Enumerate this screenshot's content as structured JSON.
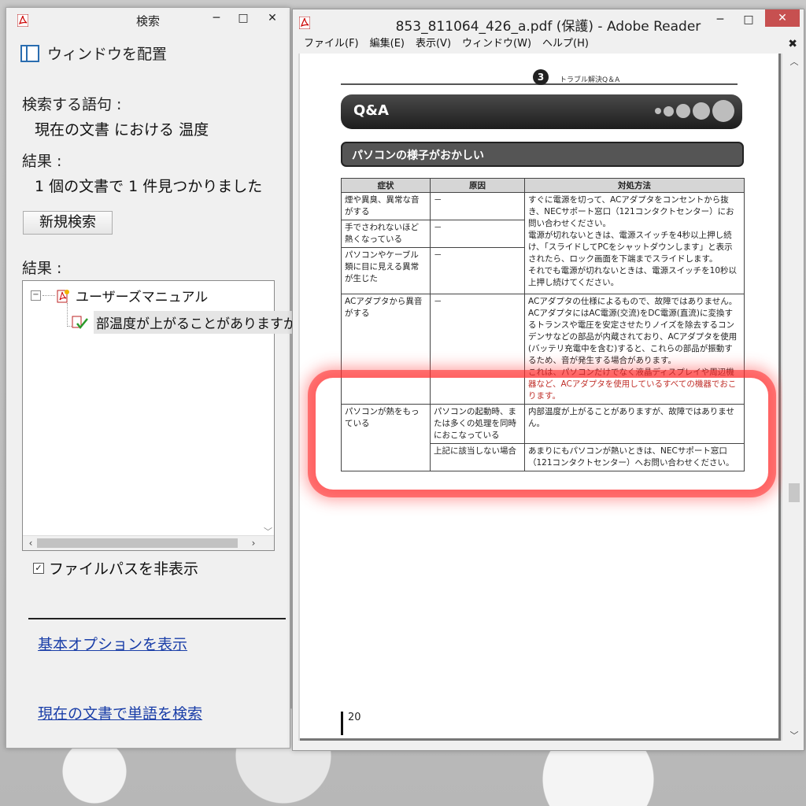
{
  "search_window": {
    "title": "検索",
    "arrange_label": "ウィンドウを配置",
    "query_label": "検索する語句 :",
    "query_value": "現在の文書 における 温度",
    "result_label": "結果 :",
    "result_value": "1 個の文書で 1 件見つかりました",
    "new_search_button": "新規検索",
    "results_label": "結果 :",
    "tree": {
      "doc_name": "ユーザーズマニュアル",
      "hit_text": "部温度が上がることがありますが"
    },
    "hide_path_label": "ファイルパスを非表示",
    "hide_path_checked": true,
    "link_options": "基本オプションを表示",
    "link_word_search": "現在の文書で単語を検索"
  },
  "reader_window": {
    "title": "853_811064_426_a.pdf (保護) - Adobe Reader",
    "menu": [
      "ファイル(F)",
      "編集(E)",
      "表示(V)",
      "ウィンドウ(W)",
      "ヘルプ(H)"
    ],
    "page": {
      "chapter_number": "3",
      "chapter_title": "トラブル解決Q＆A",
      "qa_label": "Q&A",
      "section_title": "パソコンの様子がおかしい",
      "table_headers": [
        "症状",
        "原因",
        "対処方法"
      ],
      "rows": {
        "r1_symptom": "煙や異臭、異常な音がする",
        "r2_symptom": "手でさわれないほど熱くなっている",
        "r3_symptom": "パソコンやケーブル類に目に見える異常が生じた",
        "dash": "－",
        "r1_remedy": "すぐに電源を切って、ACアダプタをコンセントから抜き、NECサポート窓口（121コンタクトセンター）にお問い合わせください。\n電源が切れないときは、電源スイッチを4秒以上押し続け、「スライドしてPCをシャットダウンします」と表示されたら、ロック画面を下端までスライドします。\nそれでも電源が切れないときは、電源スイッチを10秒以上押し続けてください。",
        "r4_symptom": "ACアダプタから異音がする",
        "r4_remedy_a": "ACアダプタの仕様によるもので、故障ではありません。ACアダプタにはAC電源(交流)をDC電源(直流)に変換するトランスや電圧を安定させたりノイズを除去するコンデンサなどの部品が内蔵されており、ACアダプタを使用(バッテリ充電中を含む)すると、これらの部品が振動するため、音が発生する場合があります。\nこれは、パソコンだけでなく液晶ディスプレイや周辺機",
        "r4_remedy_b": "器など、ACアダプタを使用しているすべての機器でおこります。",
        "r5_symptom": "パソコンが熱をもっている",
        "r5_cause": "パソコンの起動時、または多くの処理を同時におこなっている",
        "r5_remedy": "内部温度が上がることがありますが、故障ではありません。",
        "r6_cause": "上記に該当しない場合",
        "r6_remedy": "あまりにもパソコンが熱いときは、NECサポート窓口（121コンタクトセンター）へお問い合わせください。"
      },
      "page_number": "20"
    }
  },
  "colors": {
    "highlight": "#ff3030",
    "link": "#1a3ea8",
    "close_button": "#c75050"
  }
}
